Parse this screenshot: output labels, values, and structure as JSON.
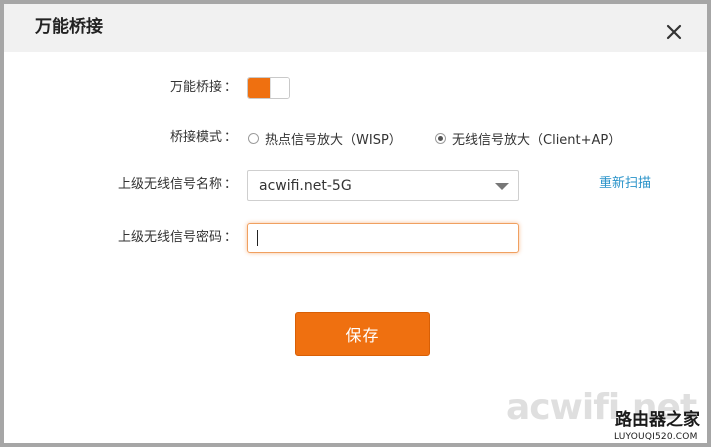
{
  "dialog": {
    "title": "万能桥接",
    "close_icon": "close-icon"
  },
  "form": {
    "bridge_label": "万能桥接",
    "bridge_enabled": true,
    "mode_label": "桥接模式",
    "mode_options": [
      {
        "label": "热点信号放大（WISP）",
        "checked": false
      },
      {
        "label": "无线信号放大（Client+AP）",
        "checked": true
      }
    ],
    "ssid_label": "上级无线信号名称",
    "ssid_value": "acwifi.net-5G",
    "rescan_label": "重新扫描",
    "password_label": "上级无线信号密码",
    "password_value": "",
    "colon": "："
  },
  "actions": {
    "save_label": "保存"
  },
  "watermark": {
    "main": "acwifi.net",
    "cn": "路由器之家",
    "url": "LUYOUQI520.COM"
  },
  "colors": {
    "accent": "#ef7010",
    "link": "#2a93c9"
  }
}
